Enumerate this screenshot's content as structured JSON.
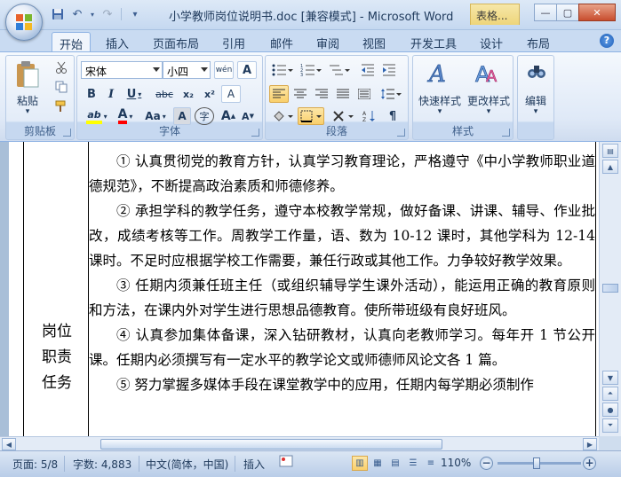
{
  "window": {
    "title": "小学教师岗位说明书.doc [兼容模式] - Microsoft Word",
    "context_tab": "表格...",
    "controls": {
      "minimize": "—",
      "maximize": "▢",
      "close": "✕"
    }
  },
  "qat": {
    "save": "💾",
    "undo": "↶",
    "redo": "↷",
    "more": "▾"
  },
  "tabs": [
    {
      "label": "开始",
      "active": true
    },
    {
      "label": "插入"
    },
    {
      "label": "页面布局"
    },
    {
      "label": "引用"
    },
    {
      "label": "邮件"
    },
    {
      "label": "审阅"
    },
    {
      "label": "视图"
    },
    {
      "label": "开发工具"
    },
    {
      "label": "设计"
    },
    {
      "label": "布局"
    }
  ],
  "help": "?",
  "ribbon": {
    "clipboard": {
      "paste": "粘贴",
      "label": "剪贴板"
    },
    "font": {
      "face": "宋体",
      "size": "小四",
      "label": "字体",
      "bold": "B",
      "italic": "I",
      "underline": "U",
      "strike": "abc",
      "subscript": "x₂",
      "superscript": "x²",
      "clear": "A",
      "highlight": "ab",
      "color": "A",
      "case": "Aa",
      "shade": "A",
      "enclose": "字",
      "grow": "A",
      "shrink": "A",
      "phonetic": "wén",
      "border": "A"
    },
    "paragraph": {
      "label": "段落"
    },
    "styles": {
      "quick": "快速样式",
      "change": "更改样式",
      "label": "样式"
    },
    "editing": {
      "label": "编辑"
    }
  },
  "document": {
    "cell_label": [
      "岗位",
      "职责",
      "任务"
    ],
    "paragraphs": [
      "① 认真贯彻党的教育方针，认真学习教育理论，严格遵守《中小学教师职业道德规范》，不断提高政治素质和师德修养。",
      "② 承担学科的教学任务，遵守本校教学常规，做好备课、讲课、辅导、作业批改，成绩考核等工作。周教学工作量，语、数为 10-12 课时，其他学科为 12-14 课时。不足时应根据学校工作需要，兼任行政或其他工作。力争较好教学效果。",
      "③ 任期内须兼任班主任（或组织辅导学生课外活动），能运用正确的教育原则和方法，在课内外对学生进行思想品德教育。使所带班级有良好班风。",
      "④ 认真参加集体备课，深入钻研教材，认真向老教师学习。每年开 1 节公开课。任期内必须撰写有一定水平的教学论文或师德师风论文各 1 篇。",
      "⑤ 努力掌握多媒体手段在课堂教学中的应用，任期内每学期必须制作"
    ]
  },
  "status": {
    "page": "页面: 5/8",
    "words": "字数: 4,883",
    "language": "中文(简体，中国)",
    "mode": "插入",
    "zoom": "110%",
    "zoom_level_percent": 110
  },
  "colors": {
    "accent": "#1e395b",
    "ribbon_bg": "#dfe9f7",
    "highlight": "#f9cf6b",
    "font_color_bar": "#ff0000",
    "highlight_bar": "#ffff00"
  }
}
